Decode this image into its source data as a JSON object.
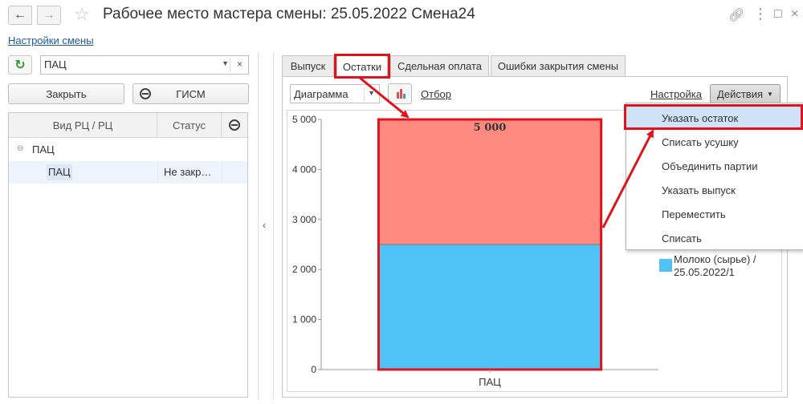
{
  "window": {
    "title": "Рабочее место мастера смены: 25.05.2022 Смена24",
    "settings_link": "Настройки смены"
  },
  "left": {
    "filter_value": "ПАЦ",
    "close_button": "Закрыть",
    "gism_button": "ГИСМ",
    "tree": {
      "col1": "Вид РЦ / РЦ",
      "col2": "Статус",
      "group_row": "ПАЦ",
      "rows": [
        {
          "name": "ПАЦ",
          "status": "Не закр…"
        }
      ]
    }
  },
  "right": {
    "tabs": [
      "Выпуск",
      "Остатки",
      "Сдельная оплата",
      "Ошибки закрытия смены"
    ],
    "active_tab": 1,
    "view_combo": "Диаграмма",
    "otbor_link": "Отбор",
    "nastroika_link": "Настройка",
    "actions_button": "Действия",
    "menu": [
      "Указать остаток",
      "Списать усушку",
      "Объединить партии",
      "Указать выпуск",
      "Переместить",
      "Списать"
    ],
    "highlighted_menu_index": 0
  },
  "chart_data": {
    "type": "bar",
    "stacked": true,
    "categories": [
      "ПАЦ"
    ],
    "series": [
      {
        "name": "Молоко (сырье) / 25.05.2022/1",
        "values": [
          2500
        ],
        "color": "#4fc3f7"
      },
      {
        "values": [
          2500
        ],
        "color": "#ff8a80"
      }
    ],
    "total_labels": [
      "5 000"
    ],
    "ylim": [
      0,
      5000
    ],
    "yticks": [
      0,
      1000,
      2000,
      3000,
      4000,
      5000
    ],
    "ytick_labels": [
      "0",
      "1 000",
      "2 000",
      "3 000",
      "4 000",
      "5 000"
    ],
    "grid": false,
    "legend_position": "right"
  },
  "colors": {
    "highlight_red": "#e0131a",
    "link_blue": "#1d5ba3",
    "menu_highlight": "#cfe2f7"
  }
}
